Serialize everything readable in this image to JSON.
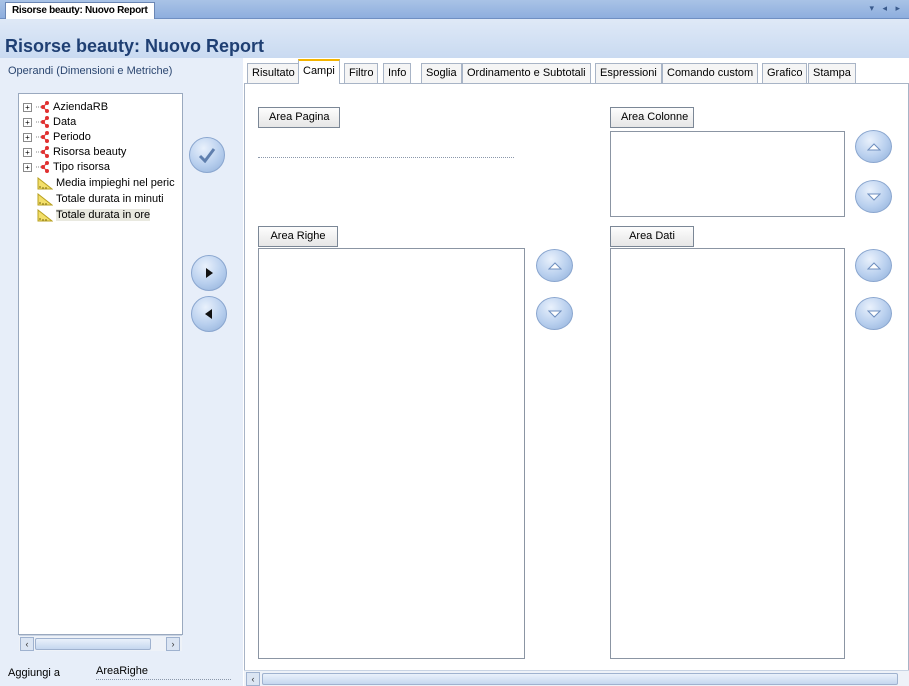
{
  "doc_tab": {
    "label": "Risorse beauty: Nuovo Report"
  },
  "window_controls": {
    "text": "▾ ◂ ▸"
  },
  "title": "Risorse beauty: Nuovo Report",
  "left_panel": {
    "header": "Operandi (Dimensioni e Metriche)",
    "tree": [
      {
        "label": "AziendaRB",
        "type": "dimension",
        "expander": "+"
      },
      {
        "label": "Data",
        "type": "dimension",
        "expander": "+"
      },
      {
        "label": "Periodo",
        "type": "dimension",
        "expander": "+"
      },
      {
        "label": "Risorsa beauty",
        "type": "dimension",
        "expander": "+"
      },
      {
        "label": "Tipo risorsa",
        "type": "dimension",
        "expander": "+"
      },
      {
        "label": "Media impieghi nel peric",
        "type": "metric"
      },
      {
        "label": "Totale durata in minuti",
        "type": "metric"
      },
      {
        "label": "Totale durata in ore",
        "type": "metric",
        "selected": true
      }
    ],
    "scroll_arrows": {
      "left": "‹",
      "right": "›"
    },
    "aggiungi_label": "Aggiungi a",
    "aggiungi_value": "AreaRighe"
  },
  "tabs": [
    {
      "label": "Risultato"
    },
    {
      "label": "Campi",
      "active": true
    },
    {
      "label": "Filtro"
    },
    {
      "label": "Info"
    },
    {
      "label": "Soglia"
    },
    {
      "label": "Ordinamento e Subtotali"
    },
    {
      "label": "Espressioni"
    },
    {
      "label": "Comando custom"
    },
    {
      "label": "Grafico"
    },
    {
      "label": "Stampa"
    }
  ],
  "areas": {
    "pagina": "Area Pagina",
    "colonne": "Area Colonne",
    "righe": "Area Righe",
    "dati": "Area Dati"
  },
  "colors": {
    "accent": "#1f3f73",
    "active_tab_top": "#f4b400",
    "panel_bg": "#e7eef9"
  }
}
